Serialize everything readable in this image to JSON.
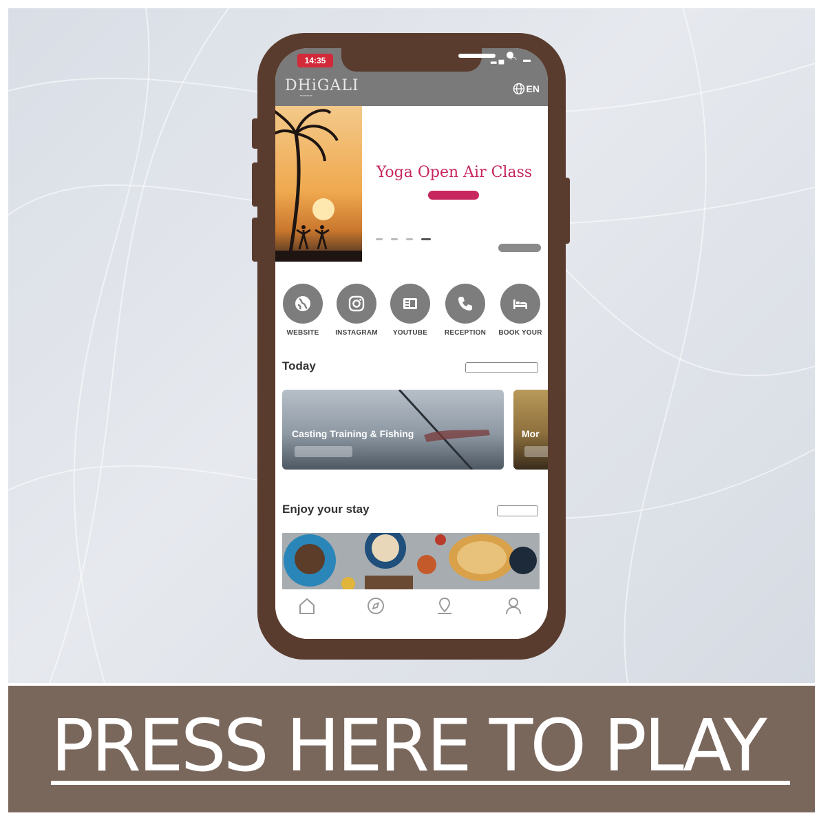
{
  "banner": {
    "cta_text": "PRESS HERE TO PLAY"
  },
  "status": {
    "time": "14:35",
    "icons": "▂▄ ◠ ▬"
  },
  "app": {
    "logo": "DHiGALI",
    "language": "EN"
  },
  "hero": {
    "title": "Yoga Open Air Class",
    "button_label": "",
    "see_more_label": ""
  },
  "quick_links": [
    {
      "label": "WEBSITE",
      "icon": "globe-icon"
    },
    {
      "label": "INSTAGRAM",
      "icon": "instagram-icon"
    },
    {
      "label": "YOUTUBE",
      "icon": "youtube-icon"
    },
    {
      "label": "RECEPTION",
      "icon": "phone-icon"
    },
    {
      "label": "BOOK YOUR",
      "icon": "bed-icon"
    }
  ],
  "today": {
    "title": "Today",
    "upcoming_label": "",
    "events": [
      {
        "title": "Casting Training & Fishing",
        "time": ""
      },
      {
        "title": "Mor",
        "time": ""
      }
    ]
  },
  "enjoy": {
    "title": "Enjoy your stay",
    "view_all_label": ""
  },
  "tabs": [
    {
      "icon": "home-icon"
    },
    {
      "icon": "compass-icon"
    },
    {
      "icon": "map-pin-icon"
    },
    {
      "icon": "profile-icon"
    }
  ],
  "colors": {
    "brand_brown": "#5a3c2e",
    "banner": "#7a675c",
    "accent_pink": "#c7265f",
    "status_red": "#d32a3a",
    "header_grey": "#7a7a7a"
  }
}
